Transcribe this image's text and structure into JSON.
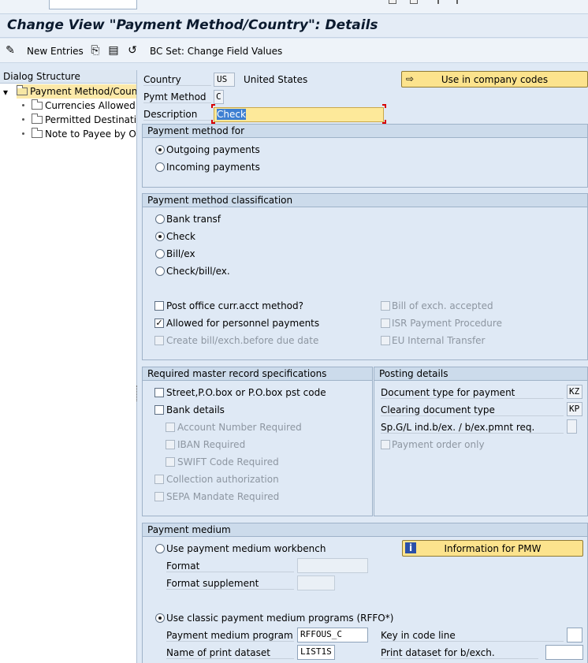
{
  "window": {
    "title": "Change View \"Payment Method/Country\": Details"
  },
  "toolbar": {
    "new_entries": "New Entries",
    "bc_set": "BC Set: Change Field Values",
    "icons": [
      "glasses-edit-icon",
      "copy-icon",
      "save-local-icon",
      "undo-icon"
    ]
  },
  "dialog": {
    "title": "Dialog Structure",
    "items": [
      {
        "label": "Payment Method/Count",
        "selected": true
      },
      {
        "label": "Currencies Allowed"
      },
      {
        "label": "Permitted Destinatio"
      },
      {
        "label": "Note to Payee by Or"
      }
    ]
  },
  "header": {
    "country_label": "Country",
    "country_code": "US",
    "country_name": "United States",
    "pymt_method_label": "Pymt Method",
    "pymt_method_value": "C",
    "description_label": "Description",
    "description_value": "Check",
    "use_in_company_codes": "Use in company codes"
  },
  "payment_method_for": {
    "title": "Payment method for",
    "outgoing": "Outgoing payments",
    "incoming": "Incoming payments",
    "selected": "outgoing"
  },
  "classification": {
    "title": "Payment method classification",
    "options": [
      "Bank transf",
      "Check",
      "Bill/ex",
      "Check/bill/ex."
    ],
    "selected": "Check",
    "post_office": "Post office curr.acct method?",
    "allowed_personnel": "Allowed for personnel payments",
    "create_bill": "Create bill/exch.before due date",
    "bill_accepted": "Bill of exch. accepted",
    "isr": "ISR Payment Procedure",
    "eu_transfer": "EU Internal Transfer"
  },
  "master_record": {
    "title": "Required master record specifications",
    "street": "Street,P.O.box or P.O.box pst code",
    "bank_details": "Bank details",
    "account_number": "Account Number Required",
    "iban": "IBAN Required",
    "swift": "SWIFT Code Required",
    "collection": "Collection authorization",
    "sepa": "SEPA Mandate Required"
  },
  "posting": {
    "title": "Posting details",
    "doc_type_label": "Document type for payment",
    "doc_type_value": "KZ",
    "clearing_label": "Clearing document type",
    "clearing_value": "KP",
    "spgl_label": "Sp.G/L ind.b/ex. / b/ex.pmnt req.",
    "spgl_value": "",
    "payment_order_only": "Payment order only"
  },
  "payment_medium": {
    "title": "Payment medium",
    "use_pmw": "Use payment medium workbench",
    "info_pmw": "Information for PMW",
    "format_label": "Format",
    "format_supplement_label": "Format supplement",
    "use_classic": "Use classic payment medium programs (RFFO*)",
    "program_label": "Payment medium program",
    "program_value": "RFFOUS_C",
    "print_dataset_label": "Name of print dataset",
    "print_dataset_value": "LIST1S",
    "key_code_line_label": "Key in code line",
    "print_bex_label": "Print dataset for b/exch.",
    "selected": "classic"
  }
}
